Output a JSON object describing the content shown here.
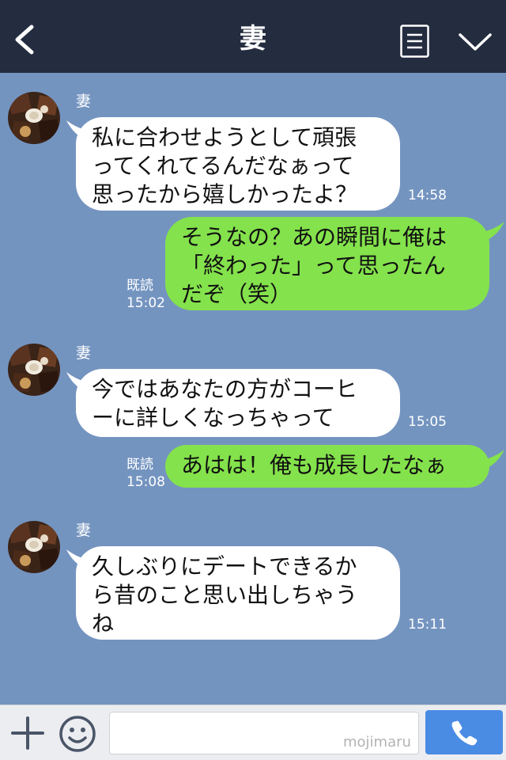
{
  "header": {
    "title": "妻"
  },
  "messages": [
    {
      "direction": "incoming",
      "sender": "妻",
      "text": "私に合わせようとして頑張\nってくれてるんだなぁって\n思ったから嬉しかったよ？",
      "time": "14:58"
    },
    {
      "direction": "outgoing",
      "text": "そうなの？あの瞬間に俺は\n「終わった」って思ったん\nだぞ（笑）",
      "read": "既読",
      "time": "15:02"
    },
    {
      "direction": "incoming",
      "sender": "妻",
      "text": "今ではあなたの方がコーヒ\nーに詳しくなっちゃって",
      "time": "15:05"
    },
    {
      "direction": "outgoing",
      "text": "あはは！俺も成長したなぁ",
      "read": "既読",
      "time": "15:08"
    },
    {
      "direction": "incoming",
      "sender": "妻",
      "text": "久しぶりにデートできるか\nら昔のこと思い出しちゃう\nね",
      "time": "15:11"
    }
  ],
  "footer": {
    "input_value": "",
    "watermark": "mojimaru"
  },
  "icons": {
    "back": "back-chevron-icon",
    "menu": "menu-icon",
    "collapse": "chevron-down-icon",
    "add": "plus-icon",
    "sticker": "smile-icon",
    "call": "phone-icon"
  },
  "colors": {
    "header_bg": "#242c40",
    "chat_bg": "#7494c0",
    "incoming_bubble": "#ffffff",
    "outgoing_bubble": "#84e24c",
    "call_button": "#4a8be4"
  }
}
